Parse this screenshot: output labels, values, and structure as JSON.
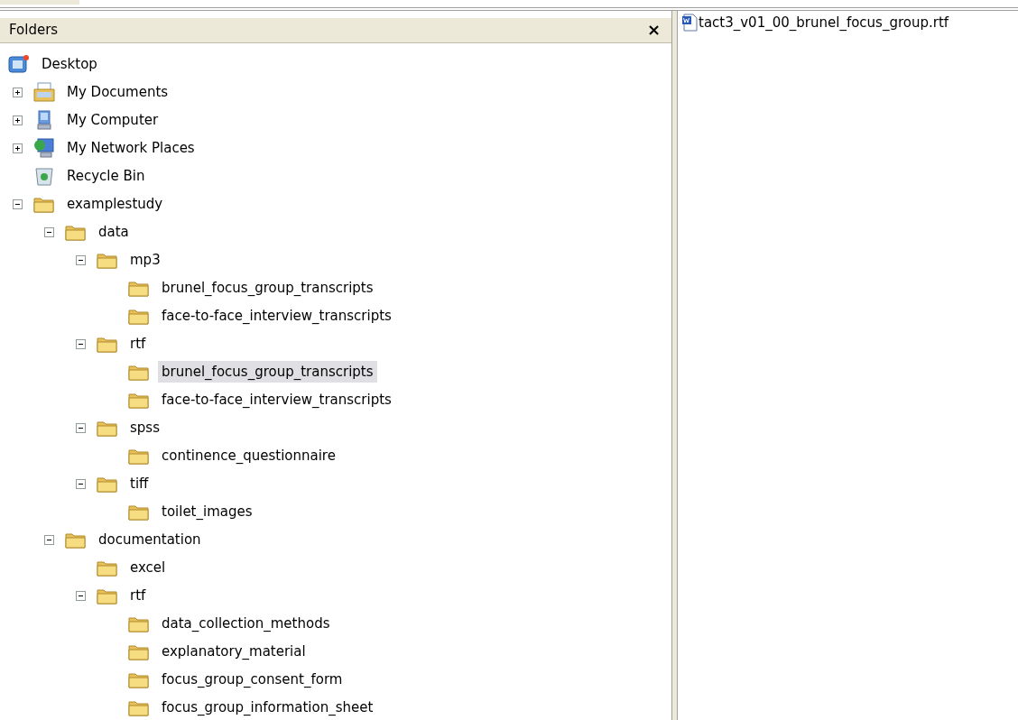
{
  "folders_pane": {
    "title": "Folders",
    "close": "×"
  },
  "tree": [
    {
      "label": "Desktop",
      "kind": "desktop",
      "selected": false,
      "children": [
        {
          "label": "My Documents",
          "kind": "documents",
          "expanded": false,
          "selected": false
        },
        {
          "label": "My Computer",
          "kind": "computer",
          "expanded": false,
          "selected": false
        },
        {
          "label": "My Network Places",
          "kind": "network",
          "expanded": false,
          "selected": false
        },
        {
          "label": "Recycle Bin",
          "kind": "recycle",
          "selected": false
        },
        {
          "label": "examplestudy",
          "kind": "folder",
          "expanded": true,
          "selected": false,
          "children": [
            {
              "label": "data",
              "kind": "folder",
              "expanded": true,
              "selected": false,
              "children": [
                {
                  "label": "mp3",
                  "kind": "folder",
                  "expanded": true,
                  "selected": false,
                  "children": [
                    {
                      "label": "brunel_focus_group_transcripts",
                      "kind": "folder",
                      "selected": false
                    },
                    {
                      "label": "face-to-face_interview_transcripts",
                      "kind": "folder",
                      "selected": false
                    }
                  ]
                },
                {
                  "label": "rtf",
                  "kind": "folder",
                  "expanded": true,
                  "selected": false,
                  "children": [
                    {
                      "label": "brunel_focus_group_transcripts",
                      "kind": "folder",
                      "selected": true
                    },
                    {
                      "label": "face-to-face_interview_transcripts",
                      "kind": "folder",
                      "selected": false
                    }
                  ]
                },
                {
                  "label": "spss",
                  "kind": "folder",
                  "expanded": true,
                  "selected": false,
                  "children": [
                    {
                      "label": "continence_questionnaire",
                      "kind": "folder",
                      "selected": false
                    }
                  ]
                },
                {
                  "label": "tiff",
                  "kind": "folder",
                  "expanded": true,
                  "selected": false,
                  "children": [
                    {
                      "label": "toilet_images",
                      "kind": "folder",
                      "selected": false
                    }
                  ]
                }
              ]
            },
            {
              "label": "documentation",
              "kind": "folder",
              "expanded": true,
              "selected": false,
              "children": [
                {
                  "label": "excel",
                  "kind": "folder",
                  "selected": false
                },
                {
                  "label": "rtf",
                  "kind": "folder",
                  "expanded": true,
                  "selected": false,
                  "children": [
                    {
                      "label": "data_collection_methods",
                      "kind": "folder",
                      "selected": false
                    },
                    {
                      "label": "explanatory_material",
                      "kind": "folder",
                      "selected": false
                    },
                    {
                      "label": "focus_group_consent_form",
                      "kind": "folder",
                      "selected": false
                    },
                    {
                      "label": "focus_group_information_sheet",
                      "kind": "folder",
                      "selected": false
                    }
                  ]
                }
              ]
            }
          ]
        }
      ]
    }
  ],
  "file_list": [
    {
      "name": "tact3_v01_00_brunel_focus_group.rtf",
      "kind": "word-document"
    }
  ]
}
